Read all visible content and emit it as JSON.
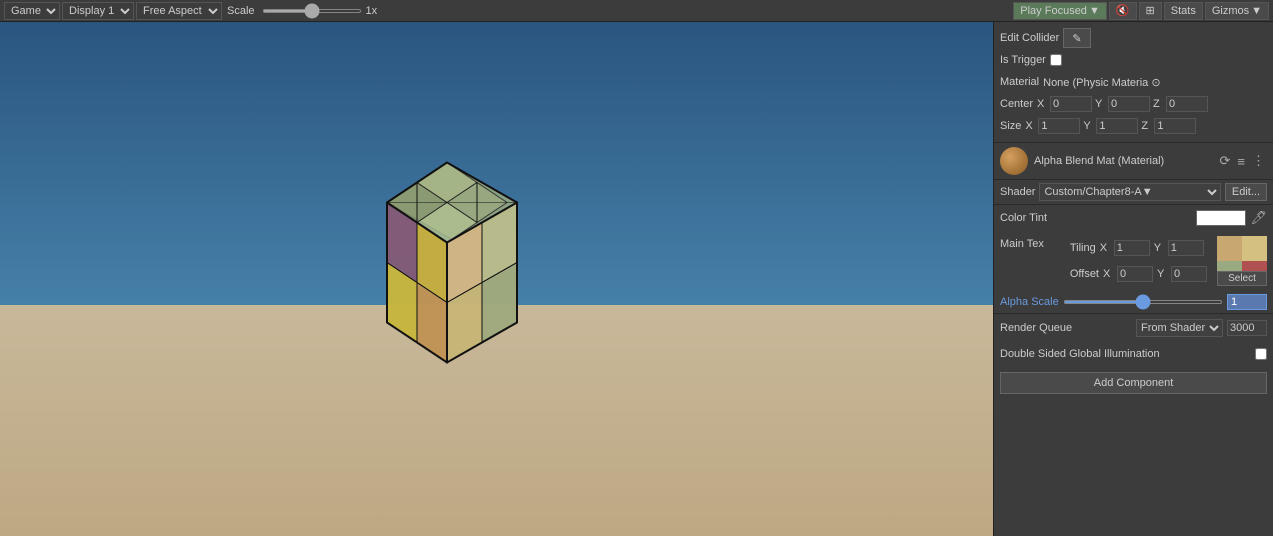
{
  "toolbar": {
    "game_label": "Game",
    "display_label": "Display 1",
    "aspect_label": "Free Aspect",
    "scale_label": "Scale",
    "scale_value": "1x",
    "play_focused_label": "Play Focused",
    "stats_label": "Stats",
    "gizmos_label": "Gizmos",
    "mute_icon": "🔇"
  },
  "inspector": {
    "box_collider_section": {
      "edit_collider_label": "Edit Collider",
      "is_trigger_label": "Is Trigger",
      "material_label": "Material",
      "material_value": "None (Physic Materia ⊙",
      "center_label": "Center",
      "center_x": "0",
      "center_y": "0",
      "center_z": "0",
      "size_label": "Size",
      "size_x": "1",
      "size_y": "1",
      "size_z": "1"
    },
    "material_section": {
      "mat_name": "Alpha Blend Mat (Material)",
      "shader_label": "Shader",
      "shader_value": "Custom/Chapter8-A▼",
      "edit_label": "Edit...",
      "color_tint_label": "Color Tint",
      "main_tex_label": "Main Tex",
      "tiling_label": "Tiling",
      "tiling_x": "1",
      "tiling_y": "1",
      "offset_label": "Offset",
      "offset_x": "0",
      "offset_y": "0",
      "select_label": "Select",
      "alpha_scale_label": "Alpha Scale",
      "alpha_value": "1",
      "render_queue_label": "Render Queue",
      "render_queue_from": "From Shader",
      "render_queue_value": "3000",
      "double_sided_label": "Double Sided Global Illumination"
    },
    "add_component_label": "Add Component"
  }
}
